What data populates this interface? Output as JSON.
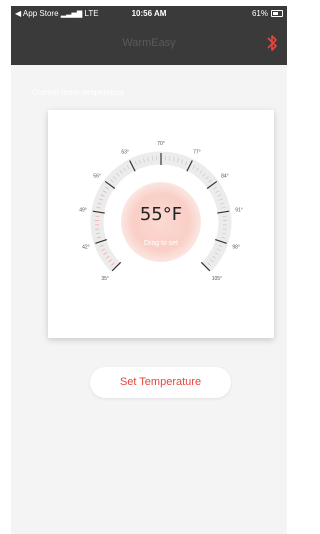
{
  "status_bar": {
    "carrier": "◀ App Store",
    "network": "LTE",
    "time": "10:56 AM",
    "battery": "61%"
  },
  "nav": {
    "title": "WarmEasy",
    "right_icon": "bluetooth-icon"
  },
  "caption": "Current room temperature",
  "dial": {
    "temperature_display": "55°F",
    "subtext": "Drag to set",
    "current_temperature_f": 55,
    "scale_min_f": 35,
    "scale_max_f": 105,
    "tick_labels": [
      "35°",
      "42°",
      "49°",
      "56°",
      "63°",
      "70°",
      "77°",
      "84°",
      "91°",
      "98°",
      "105°"
    ]
  },
  "set_button_label": "Set Temperature",
  "colors": {
    "accent": "#e8453c",
    "header_bg": "#3a3a3a",
    "page_bg": "#f4f4f4"
  }
}
